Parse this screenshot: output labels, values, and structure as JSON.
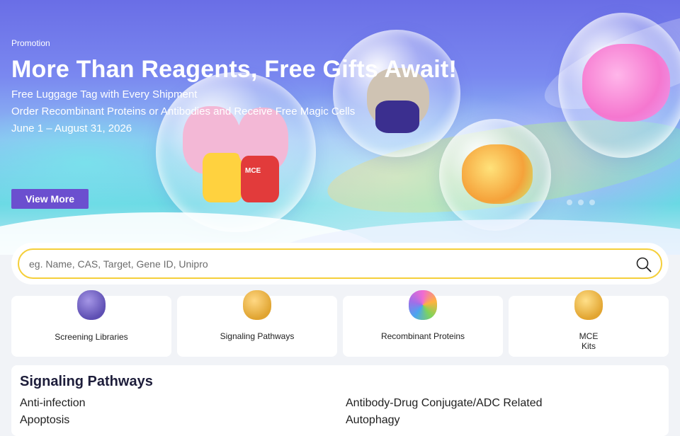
{
  "hero": {
    "eyebrow": "Promotion",
    "headline": "More Than Reagents, Free Gifts Await!",
    "lines": [
      "Free Luggage Tag with Every Shipment",
      "Order Recombinant Proteins or Antibodies and Receive Free Magic Cells",
      "June 1 – August 31, 2026"
    ],
    "cta_label": "View More",
    "mascot_text": "MCE",
    "carousel_slides": 3
  },
  "search": {
    "placeholder": "eg. Name, CAS, Target, Gene ID, Unipro",
    "value": ""
  },
  "categories": [
    {
      "label": "Screening Libraries",
      "icon": "molecule-purple-icon"
    },
    {
      "label": "Signaling Pathways",
      "icon": "molecule-gold-icon"
    },
    {
      "label": "Recombinant Proteins",
      "icon": "protein-multicolor-icon"
    },
    {
      "label": "MCE\nKits",
      "line1": "MCE",
      "line2": "Kits",
      "icon": "kit-gold-icon"
    }
  ],
  "signaling": {
    "title": "Signaling Pathways",
    "items": [
      "Anti-infection",
      "Antibody-Drug Conjugate/ADC Related",
      "Apoptosis",
      "Autophagy"
    ]
  },
  "colors": {
    "cta": "#6b4fcf",
    "search_border": "#f5cf3a",
    "page_bg": "#f1f3f7"
  }
}
